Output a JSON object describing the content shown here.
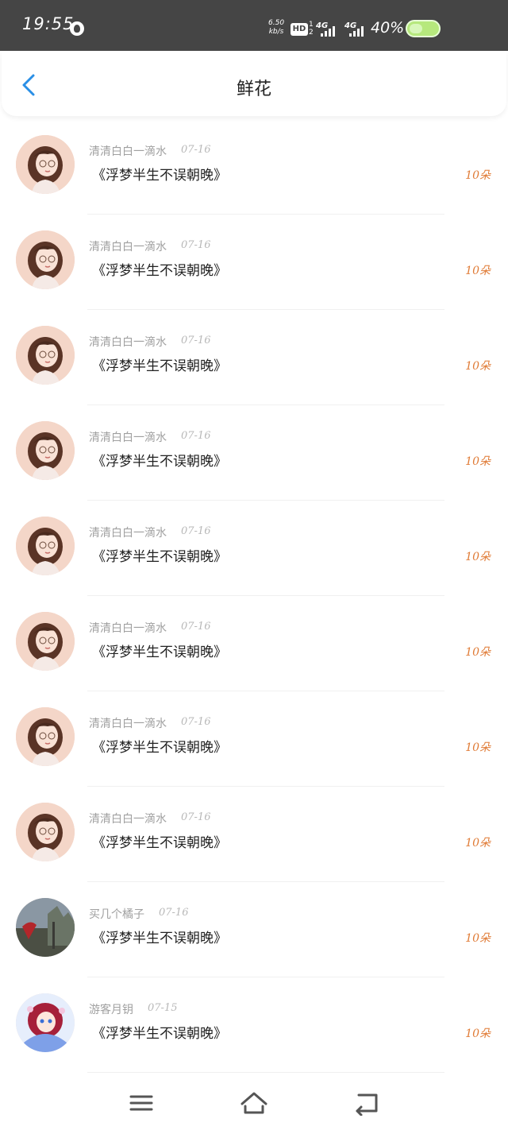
{
  "status_bar": {
    "time": "19:55",
    "net_speed_value": "6.50",
    "net_speed_unit": "kb/s",
    "hd_label": "HD",
    "hd_sim": "1",
    "hd_sim2": "2",
    "network_1": "4G",
    "network_2": "4G",
    "battery_percent": "40%",
    "battery_color": "#b6e87d"
  },
  "header": {
    "title": "鲜花",
    "back_icon": "chevron-left-icon",
    "accent_color": "#2a8fe6"
  },
  "records": [
    {
      "user": "清清白白一滴水",
      "date": "07-16",
      "title": "《浮梦半生不误朝晚》",
      "count": "10朵",
      "avatar": "girl-avatar"
    },
    {
      "user": "清清白白一滴水",
      "date": "07-16",
      "title": "《浮梦半生不误朝晚》",
      "count": "10朵",
      "avatar": "girl-avatar"
    },
    {
      "user": "清清白白一滴水",
      "date": "07-16",
      "title": "《浮梦半生不误朝晚》",
      "count": "10朵",
      "avatar": "girl-avatar"
    },
    {
      "user": "清清白白一滴水",
      "date": "07-16",
      "title": "《浮梦半生不误朝晚》",
      "count": "10朵",
      "avatar": "girl-avatar"
    },
    {
      "user": "清清白白一滴水",
      "date": "07-16",
      "title": "《浮梦半生不误朝晚》",
      "count": "10朵",
      "avatar": "girl-avatar"
    },
    {
      "user": "清清白白一滴水",
      "date": "07-16",
      "title": "《浮梦半生不误朝晚》",
      "count": "10朵",
      "avatar": "girl-avatar"
    },
    {
      "user": "清清白白一滴水",
      "date": "07-16",
      "title": "《浮梦半生不误朝晚》",
      "count": "10朵",
      "avatar": "girl-avatar"
    },
    {
      "user": "清清白白一滴水",
      "date": "07-16",
      "title": "《浮梦半生不误朝晚》",
      "count": "10朵",
      "avatar": "girl-avatar"
    },
    {
      "user": "买几个橘子",
      "date": "07-16",
      "title": "《浮梦半生不误朝晚》",
      "count": "10朵",
      "avatar": "scenery-avatar"
    },
    {
      "user": "游客月钥",
      "date": "07-15",
      "title": "《浮梦半生不误朝晚》",
      "count": "10朵",
      "avatar": "anime-avatar"
    }
  ],
  "colors": {
    "count_color": "#e07b36",
    "status_bar_bg": "#454545"
  },
  "nav": {
    "menu_icon": "menu-icon",
    "home_icon": "home-icon",
    "back_icon": "back-icon"
  }
}
